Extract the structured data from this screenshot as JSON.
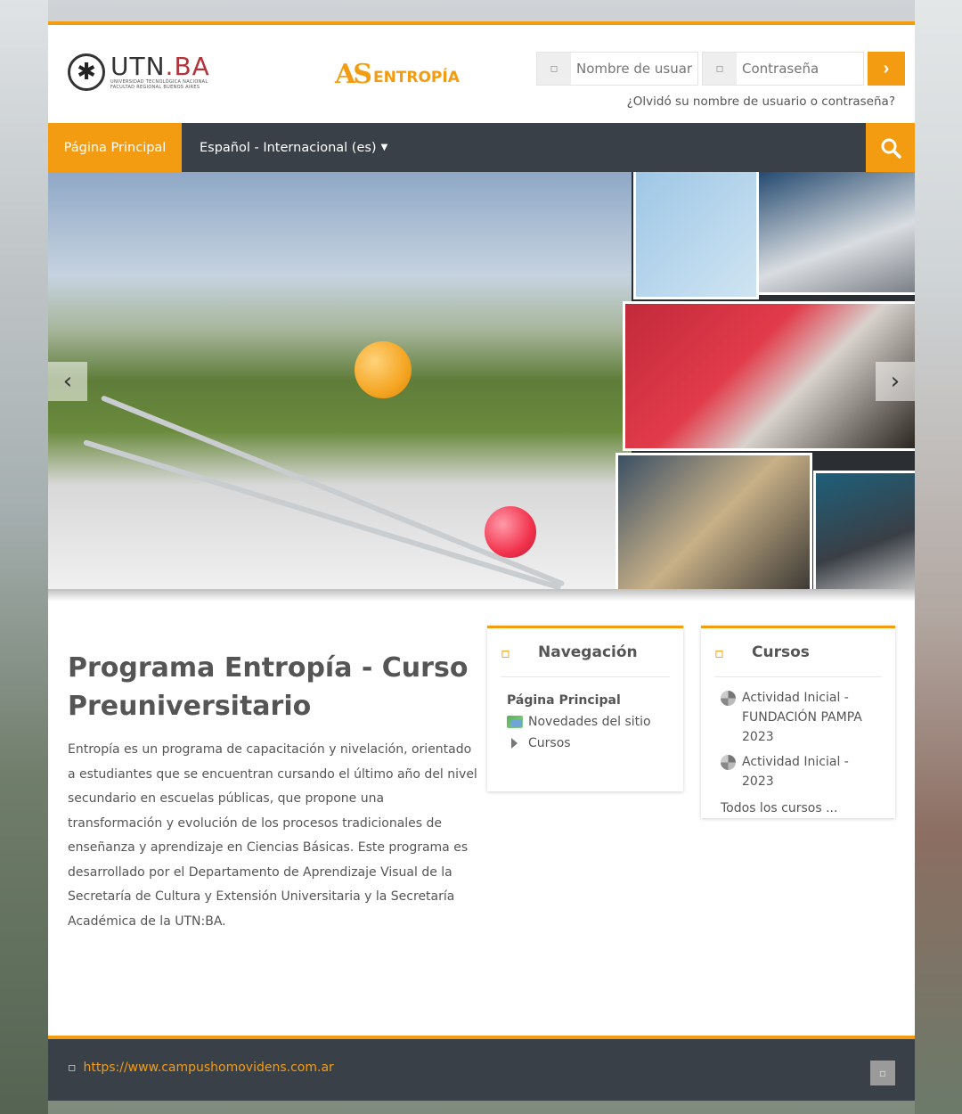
{
  "header": {
    "utn_name_main": "UTN",
    "utn_name_suffix": ".BA",
    "utn_subtitle": "UNIVERSIDAD TECNOLÓGICA NACIONAL FACULTAD REGIONAL BUENOS AIRES",
    "entropia_mark": "AS",
    "entropia_name": "ENTROPÍA",
    "login": {
      "username_placeholder": "Nombre de usuario",
      "password_placeholder": "Contraseña",
      "forgot_text": "¿Olvidó su nombre de usuario o contraseña?"
    }
  },
  "nav": {
    "home_label": "Página Principal",
    "language_label": "Español - Internacional (es)"
  },
  "carousel": {
    "prev_glyph": "‹",
    "next_glyph": "›"
  },
  "intro": {
    "title": "Programa Entropía - Curso Preuniversitario",
    "body": "Entropía es un programa de capacitación y nivelación, orientado a estudiantes que se encuentran cursando el último año del nivel secundario en escuelas públicas, que propone una transformación y evolución de los procesos tradicionales de enseñanza y aprendizaje en Ciencias Básicas. Este programa es desarrollado por el Departamento de Aprendizaje Visual de la Secretaría de Cultura y Extensión Universitaria y la Secretaría Académica de la UTN:BA."
  },
  "navigation_block": {
    "title": "Navegación",
    "root": "Página Principal",
    "items": [
      "Novedades del sitio",
      "Cursos"
    ]
  },
  "courses_block": {
    "title": "Cursos",
    "courses": [
      "Actividad Inicial - FUNDACIÓN PAMPA 2023",
      "Actividad Inicial - 2023"
    ],
    "all_courses": "Todos los cursos ..."
  },
  "footer": {
    "link": "https://www.campushomovidens.com.ar"
  },
  "colors": {
    "accent": "#f39c12",
    "nav_bg": "#3a4047",
    "text": "#555555"
  }
}
